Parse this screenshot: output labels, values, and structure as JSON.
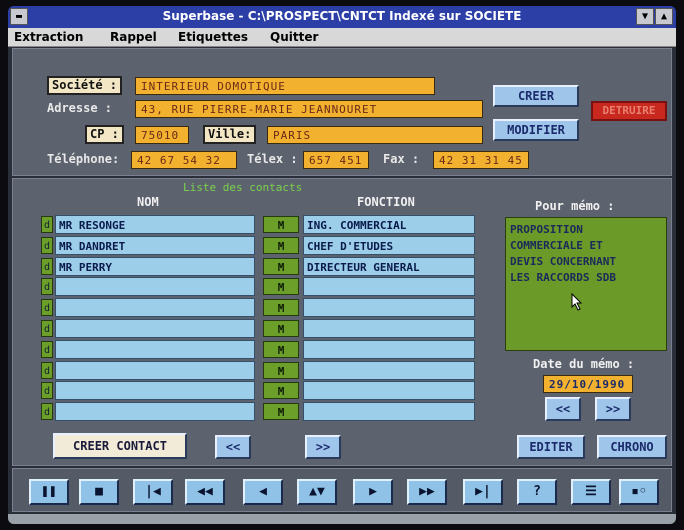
{
  "window": {
    "title": "Superbase - C:\\PROSPECT\\CNTCT Indexé sur SOCIETE",
    "control_menu_icon": "dash-icon",
    "scroll_up_icon": "triangle-up-icon",
    "scroll_down_icon": "triangle-down-icon"
  },
  "menu": {
    "items": [
      "Extraction",
      "Rappel",
      "Etiquettes",
      "Quitter"
    ]
  },
  "form": {
    "societe_label": "Société :",
    "societe_value": "INTERIEUR DOMOTIQUE",
    "adresse_label": "Adresse :",
    "adresse_value": "43, RUE PIERRE-MARIE JEANNOURET",
    "cp_label": "CP :",
    "cp_value": "75010",
    "ville_label": "Ville:",
    "ville_value": "PARIS",
    "telephone_label": "Téléphone:",
    "telephone_value": "42 67 54 32",
    "telex_label": "Télex :",
    "telex_value": "657 451",
    "fax_label": "Fax :",
    "fax_value": "42 31 31 45"
  },
  "buttons": {
    "creer": "CREER",
    "modifier": "MODIFIER",
    "detruire": "DETRUIRE",
    "creer_contact": "CREER CONTACT",
    "prev": "<<",
    "next": ">>",
    "editer": "EDITER",
    "chrono": "CHRONO"
  },
  "contacts": {
    "list_title": "Liste des contacts",
    "nom_header": "NOM",
    "fonction_header": "FONCTION",
    "row_marker": "d",
    "m_marker": "M",
    "rows": [
      {
        "nom": "MR RESONGE",
        "fonction": "ING. COMMERCIAL"
      },
      {
        "nom": "MR DANDRET",
        "fonction": "CHEF D'ETUDES"
      },
      {
        "nom": "MR PERRY",
        "fonction": "DIRECTEUR GENERAL"
      },
      {
        "nom": "",
        "fonction": ""
      },
      {
        "nom": "",
        "fonction": ""
      },
      {
        "nom": "",
        "fonction": ""
      },
      {
        "nom": "",
        "fonction": ""
      },
      {
        "nom": "",
        "fonction": ""
      },
      {
        "nom": "",
        "fonction": ""
      },
      {
        "nom": "",
        "fonction": ""
      }
    ]
  },
  "memo": {
    "label": "Pour mémo :",
    "lines": [
      "PROPOSITION",
      "COMMERCIALE ET",
      "DEVIS CONCERNANT",
      "LES RACCORDS SDB"
    ],
    "date_label": "Date du mémo :",
    "date_value": "29/10/1990"
  },
  "transport": {
    "buttons": [
      {
        "icon": "pause-icon",
        "glyph": "❚❚"
      },
      {
        "icon": "stop-icon",
        "glyph": "■"
      },
      {
        "icon": "skip-first-icon",
        "glyph": "|◀"
      },
      {
        "icon": "fast-rewind-icon",
        "glyph": "◀◀"
      },
      {
        "icon": "step-back-icon",
        "glyph": "◀"
      },
      {
        "icon": "up-down-icon",
        "glyph": "▲▼"
      },
      {
        "icon": "play-icon",
        "glyph": "▶"
      },
      {
        "icon": "fast-forward-icon",
        "glyph": "▶▶"
      },
      {
        "icon": "skip-last-icon",
        "glyph": "▶|"
      },
      {
        "icon": "help-icon",
        "glyph": "?"
      },
      {
        "icon": "menu-lines-icon",
        "glyph": "☰"
      },
      {
        "icon": "toggle-icon",
        "glyph": "▪◦"
      }
    ]
  },
  "colors": {
    "title_bar": "#2b3fa6",
    "field_yellow": "#f2b12e",
    "cell_blue": "#9ccde9",
    "memo_green": "#6b9a28",
    "delete_red": "#c8281e"
  }
}
